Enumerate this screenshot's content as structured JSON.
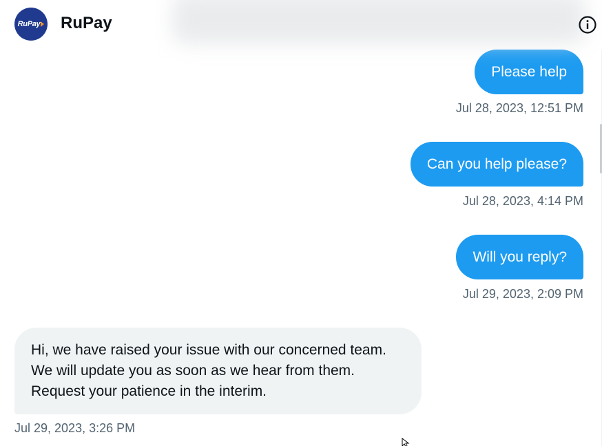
{
  "header": {
    "avatar_text": "RuPay",
    "name": "RuPay"
  },
  "icons": {
    "info": "info-circle-icon",
    "avatar_mark": "orange-arrow-icon",
    "cursor": "mouse-pointer-icon"
  },
  "colors": {
    "outgoing_bubble": "#1d9bf0",
    "incoming_bubble": "#eff3f4",
    "timestamp": "#536471",
    "avatar_bg": "#1f3a8f"
  },
  "messages": [
    {
      "direction": "outgoing",
      "text": "Please help",
      "timestamp": "Jul 28, 2023, 12:51 PM"
    },
    {
      "direction": "outgoing",
      "text": "Can you help please?",
      "timestamp": "Jul 28, 2023, 4:14 PM"
    },
    {
      "direction": "outgoing",
      "text": "Will you reply?",
      "timestamp": "Jul 29, 2023, 2:09 PM"
    },
    {
      "direction": "incoming",
      "text": "Hi, we have raised your issue with our concerned team. We will update you as soon as we hear from them. Request your patience in the interim.",
      "timestamp": "Jul 29, 2023, 3:26 PM"
    }
  ]
}
